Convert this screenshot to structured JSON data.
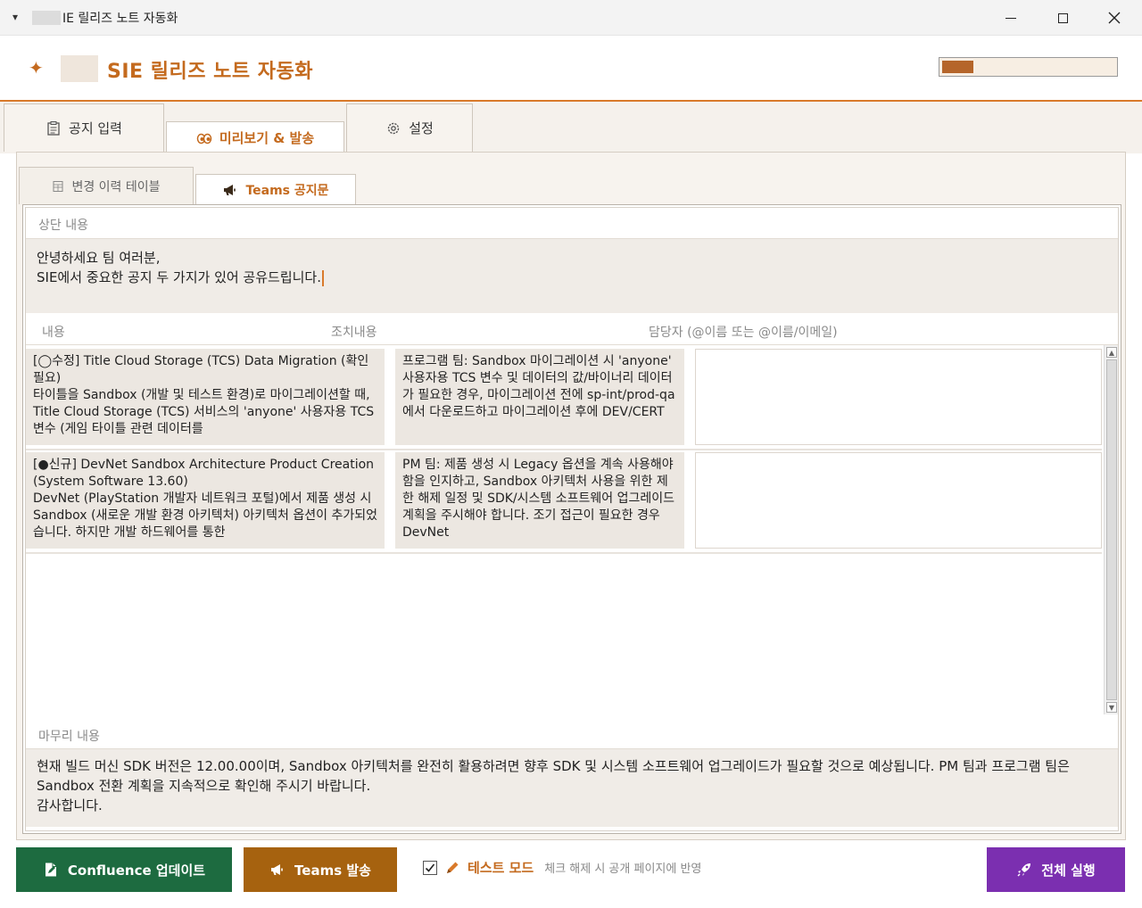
{
  "window": {
    "title": "IE 릴리즈 노트 자동화"
  },
  "header": {
    "title": "SIE 릴리즈 노트 자동화",
    "progress": 0.18
  },
  "main_tabs": [
    {
      "label": "공지 입력",
      "icon": "clipboard-icon"
    },
    {
      "label": "미리보기 & 발송",
      "icon": "eyes-icon"
    },
    {
      "label": "설정",
      "icon": "gear-icon"
    }
  ],
  "sub_tabs": [
    {
      "label": "변경 이력 테이블",
      "icon": "table-icon"
    },
    {
      "label": "Teams 공지문",
      "icon": "megaphone-icon"
    }
  ],
  "top_section": {
    "label": "상단 내용",
    "text": "안녕하세요  팀 여러분,\nSIE에서 중요한 공지 두 가지가 있어 공유드립니다."
  },
  "columns": {
    "content": "내용",
    "action": "조치내용",
    "owner": "담당자 (@이름 또는 @이름/이메일)"
  },
  "rows": [
    {
      "content": "[◯수정] Title Cloud Storage (TCS) Data Migration (확인 필요)\n타이틀을 Sandbox (개발 및 테스트 환경)로 마이그레이션할 때, Title Cloud Storage (TCS) 서비스의 'anyone' 사용자용 TCS 변수 (게임 타이틀 관련 데이터를",
      "action": "프로그램 팀: Sandbox 마이그레이션 시 'anyone' 사용자용 TCS 변수 및 데이터의 값/바이너리 데이터가 필요한 경우, 마이그레이션 전에 sp-int/prod-qa에서 다운로드하고 마이그레이션 후에 DEV/CERT",
      "owner": ""
    },
    {
      "content": "[●신규] DevNet Sandbox Architecture Product Creation (System Software 13.60)\nDevNet (PlayStation 개발자 네트워크 포털)에서 제품 생성 시 Sandbox (새로운 개발 환경 아키텍처) 아키텍처 옵션이 추가되었습니다. 하지만 개발 하드웨어를 통한",
      "action": "PM 팀: 제품 생성 시 Legacy 옵션을 계속 사용해야 함을 인지하고, Sandbox 아키텍처 사용을 위한 제한 해제 일정 및 SDK/시스템 소프트웨어 업그레이드 계획을 주시해야 합니다. 조기 접근이 필요한 경우 DevNet",
      "owner": ""
    }
  ],
  "bottom_section": {
    "label": "마무리 내용",
    "text": "    현재 빌드 머신 SDK 버전은 12.00.00이며, Sandbox 아키텍처를 완전히 활용하려면 향후 SDK 및 시스템 소프트웨어 업그레이드가 필요할 것으로 예상됩니다. PM 팀과 프로그램 팀은 Sandbox 전환 계획을 지속적으로 확인해 주시기 바랍니다.\n감사합니다."
  },
  "footer": {
    "confluence_label": "Confluence 업데이트",
    "teams_label": "Teams 발송",
    "test_mode_label": "테스트 모드",
    "test_mode_checked": true,
    "test_mode_hint": "체크 해제 시 공개 페이지에 반영",
    "run_all_label": "전체 실행"
  },
  "colors": {
    "accent": "#c46a1e",
    "confluence": "#1d6b40",
    "teams": "#a6620f",
    "run_all": "#7b2fb0"
  }
}
